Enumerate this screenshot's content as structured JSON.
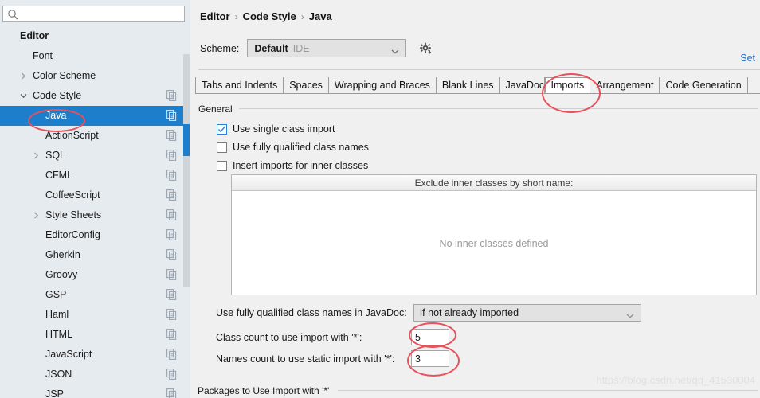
{
  "sidebar": {
    "search": {
      "placeholder": "",
      "value": "",
      "icon": "search-icon"
    },
    "tree": [
      {
        "label": "Editor",
        "indent": 0,
        "twisty": "none",
        "bold": true,
        "copy": false,
        "selected": false
      },
      {
        "label": "Font",
        "indent": 1,
        "twisty": "none",
        "bold": false,
        "copy": false,
        "selected": false
      },
      {
        "label": "Color Scheme",
        "indent": 1,
        "twisty": "collapsed",
        "bold": false,
        "copy": false,
        "selected": false
      },
      {
        "label": "Code Style",
        "indent": 1,
        "twisty": "expanded",
        "bold": false,
        "copy": true,
        "selected": false
      },
      {
        "label": "Java",
        "indent": 2,
        "twisty": "none",
        "bold": false,
        "copy": true,
        "selected": true
      },
      {
        "label": "ActionScript",
        "indent": 2,
        "twisty": "none",
        "bold": false,
        "copy": true,
        "selected": false
      },
      {
        "label": "SQL",
        "indent": 2,
        "twisty": "collapsed",
        "bold": false,
        "copy": true,
        "selected": false
      },
      {
        "label": "CFML",
        "indent": 2,
        "twisty": "none",
        "bold": false,
        "copy": true,
        "selected": false
      },
      {
        "label": "CoffeeScript",
        "indent": 2,
        "twisty": "none",
        "bold": false,
        "copy": true,
        "selected": false
      },
      {
        "label": "Style Sheets",
        "indent": 2,
        "twisty": "collapsed",
        "bold": false,
        "copy": true,
        "selected": false
      },
      {
        "label": "EditorConfig",
        "indent": 2,
        "twisty": "none",
        "bold": false,
        "copy": true,
        "selected": false
      },
      {
        "label": "Gherkin",
        "indent": 2,
        "twisty": "none",
        "bold": false,
        "copy": true,
        "selected": false
      },
      {
        "label": "Groovy",
        "indent": 2,
        "twisty": "none",
        "bold": false,
        "copy": true,
        "selected": false
      },
      {
        "label": "GSP",
        "indent": 2,
        "twisty": "none",
        "bold": false,
        "copy": true,
        "selected": false
      },
      {
        "label": "Haml",
        "indent": 2,
        "twisty": "none",
        "bold": false,
        "copy": true,
        "selected": false
      },
      {
        "label": "HTML",
        "indent": 2,
        "twisty": "none",
        "bold": false,
        "copy": true,
        "selected": false
      },
      {
        "label": "JavaScript",
        "indent": 2,
        "twisty": "none",
        "bold": false,
        "copy": true,
        "selected": false
      },
      {
        "label": "JSON",
        "indent": 2,
        "twisty": "none",
        "bold": false,
        "copy": true,
        "selected": false
      },
      {
        "label": "JSP",
        "indent": 2,
        "twisty": "none",
        "bold": false,
        "copy": true,
        "selected": false
      }
    ]
  },
  "header": {
    "breadcrumb": [
      "Editor",
      "Code Style",
      "Java"
    ],
    "separator": "›",
    "scheme_label": "Scheme:",
    "scheme_value": "Default",
    "scheme_sub": "IDE",
    "gear_icon": "gear-icon",
    "set_link": "Set"
  },
  "tabs": [
    {
      "label": "Tabs and Indents",
      "active": false
    },
    {
      "label": "Spaces",
      "active": false
    },
    {
      "label": "Wrapping and Braces",
      "active": false
    },
    {
      "label": "JavaDoc",
      "active": false,
      "clipped": true
    },
    {
      "label": "Blank Lines",
      "active": false
    },
    {
      "label": "Imports",
      "active": true
    },
    {
      "label": "Arrangement",
      "active": false
    },
    {
      "label": "Code Generation",
      "active": false
    }
  ],
  "tab_order": [
    "Tabs and Indents",
    "Spaces",
    "Wrapping and Braces",
    "Blank Lines",
    "JavaDoc",
    "Imports",
    "Arrangement",
    "Code Generation"
  ],
  "general": {
    "group_title": "General",
    "checkboxes": [
      {
        "label": "Use single class import",
        "checked": true
      },
      {
        "label": "Use fully qualified class names",
        "checked": false
      },
      {
        "label": "Insert imports for inner classes",
        "checked": false
      }
    ]
  },
  "exclude": {
    "header": "Exclude inner classes by short name:",
    "empty_text": "No inner classes defined"
  },
  "javadoc": {
    "label": "Use fully qualified class names in JavaDoc:",
    "value": "If not already imported"
  },
  "counts": [
    {
      "label": "Class count to use import with '*':",
      "value": "5"
    },
    {
      "label": "Names count to use static import with '*':",
      "value": "3"
    }
  ],
  "packages_group_title": "Packages to Use Import with '*'",
  "watermark": "https://blog.csdn.net/qq_41530004",
  "colors": {
    "selection": "#1d7fcb",
    "annotation": "#e8505b",
    "link": "#2a6fbd",
    "sidebar_bg": "#e6ebef",
    "panel_bg": "#f0f0f0"
  }
}
